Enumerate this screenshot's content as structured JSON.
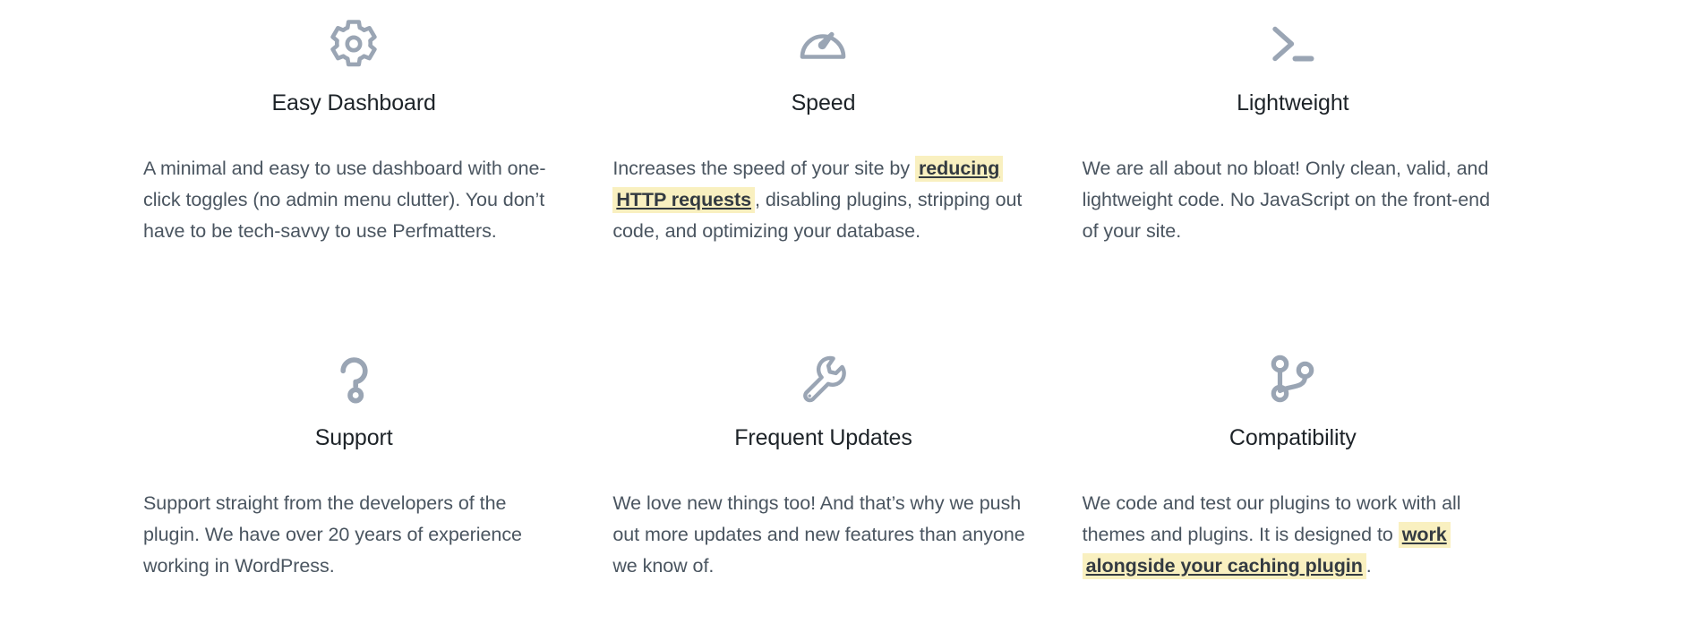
{
  "features": [
    {
      "id": "easy-dashboard",
      "icon": "gear-icon",
      "title": "Easy Dashboard",
      "body_before": "A minimal and easy to use dashboard with one-click toggles (no admin menu clutter). You don’t have to be tech-savvy to use Perfmatters.",
      "highlight": "",
      "body_after": ""
    },
    {
      "id": "speed",
      "icon": "speedometer-icon",
      "title": "Speed",
      "body_before": "Increases the speed of your site by ",
      "highlight": "reducing HTTP requests",
      "body_after": ", disabling plugins, stripping out code, and optimizing your database."
    },
    {
      "id": "lightweight",
      "icon": "terminal-prompt-icon",
      "title": "Lightweight",
      "body_before": "We are all about no bloat! Only clean, valid, and lightweight code. No JavaScript on the front-end of your site.",
      "highlight": "",
      "body_after": ""
    },
    {
      "id": "support",
      "icon": "question-mark-icon",
      "title": "Support",
      "body_before": "Support straight from the developers of the plugin. We have over 20 years of experience working in WordPress.",
      "highlight": "",
      "body_after": ""
    },
    {
      "id": "frequent-updates",
      "icon": "wrench-icon",
      "title": "Frequent Updates",
      "body_before": "We love new things too! And that’s why we push out more updates and new features than anyone we know of.",
      "highlight": "",
      "body_after": ""
    },
    {
      "id": "compatibility",
      "icon": "git-branch-icon",
      "title": "Compatibility",
      "body_before": "We code and test our plugins to work with all themes and plugins. It is designed to ",
      "highlight": "work alongside your caching plugin",
      "body_after": "."
    }
  ],
  "colors": {
    "icon": "#9aa5b4",
    "heading": "#1d2328",
    "body": "#4a5560",
    "highlight_background": "#f9f0c0",
    "highlight_text": "#333a41",
    "page_background": "#ffffff"
  }
}
